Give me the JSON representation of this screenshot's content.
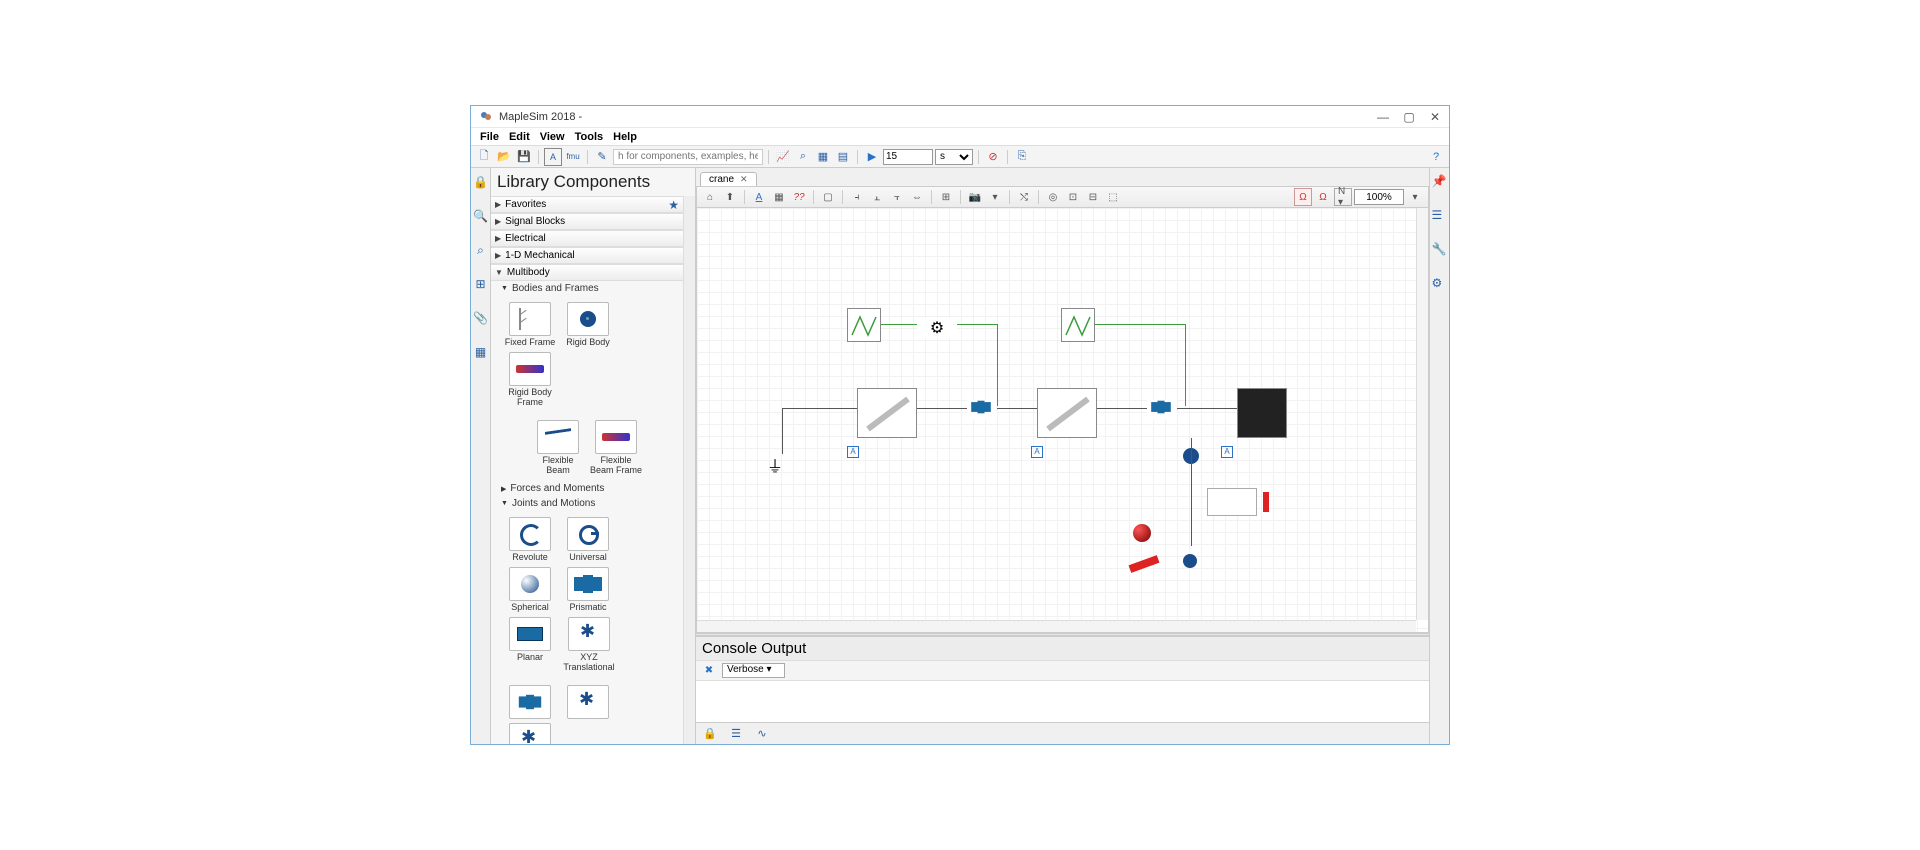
{
  "window": {
    "title": "MapleSim 2018 -"
  },
  "menu": [
    "File",
    "Edit",
    "View",
    "Tools",
    "Help"
  ],
  "toolbar": {
    "search_placeholder": "h for components, examples, help...",
    "sim_time": "15",
    "sim_units": "s"
  },
  "side": {
    "header": "Library Components",
    "categories": [
      {
        "label": "Favorites",
        "open": false,
        "star": true
      },
      {
        "label": "Signal Blocks",
        "open": false
      },
      {
        "label": "Electrical",
        "open": false
      },
      {
        "label": "1-D Mechanical",
        "open": false
      },
      {
        "label": "Multibody",
        "open": true,
        "sub": [
          {
            "label": "Bodies and Frames",
            "open": true,
            "items": [
              {
                "label": "Fixed\nFrame",
                "icon": "ico-frame"
              },
              {
                "label": "Rigid\nBody",
                "icon": "ico-rigidbody"
              },
              {
                "label": "Rigid\nBody\nFrame",
                "icon": "ico-rbframe"
              },
              {
                "label": "Flexible\nBeam",
                "icon": "ico-flexbeam"
              },
              {
                "label": "Flexible\nBeam\nFrame",
                "icon": "ico-rbframe"
              }
            ]
          },
          {
            "label": "Forces and Moments",
            "open": false
          },
          {
            "label": "Joints and Motions",
            "open": true,
            "items": [
              {
                "label": "Revolute",
                "icon": "ico-revolute"
              },
              {
                "label": "Universal",
                "icon": "ico-universal"
              },
              {
                "label": "Spherical",
                "icon": "ico-spherical"
              },
              {
                "label": "Prismatic",
                "icon": "ico-prismatic"
              },
              {
                "label": "Planar",
                "icon": "ico-planar"
              },
              {
                "label": "XYZ\nTranslational",
                "icon": "ico-xyz"
              }
            ]
          }
        ]
      }
    ]
  },
  "canvas": {
    "tab_label": "crane",
    "zoom": "100%"
  },
  "console": {
    "header": "Console Output",
    "verbose_label": "Verbose"
  }
}
